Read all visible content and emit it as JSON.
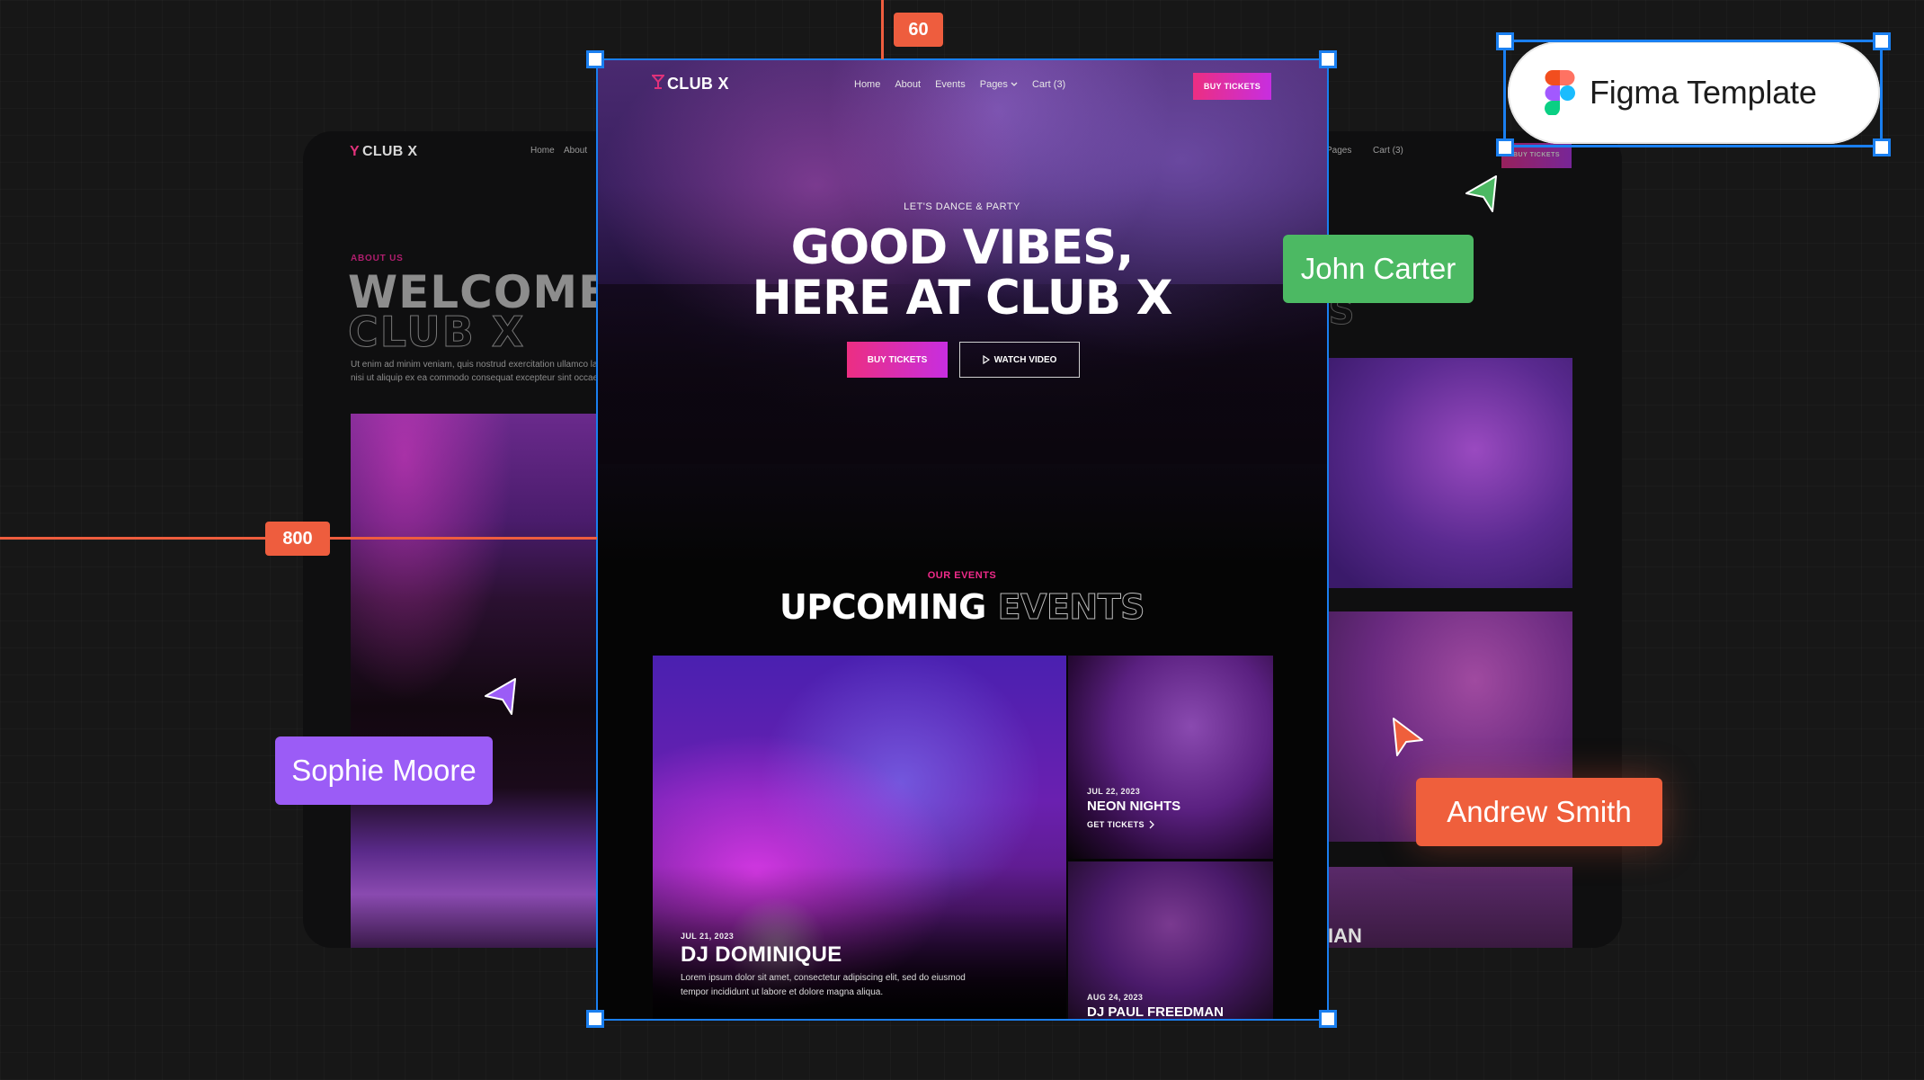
{
  "background_page": {
    "logo": "CLUB X",
    "nav": [
      "Home",
      "About",
      "Pages",
      "Cart (3)"
    ],
    "buy_label": "BUY TICKETS",
    "about_eyebrow": "ABOUT US",
    "welcome_line1": "WELCOME",
    "welcome_line2": "CLUB X",
    "body_line1": "Ut enim ad minim veniam, quis nostrud exercitation ullamco labo",
    "body_line2": "nisi ut aliquip ex ea commodo consequat excepteur sint occaecat",
    "events_ghost": "NTS",
    "partial_title": "IAN"
  },
  "frame": {
    "nav": {
      "logo": "CLUB X",
      "links": [
        "Home",
        "About",
        "Events",
        "Pages",
        "Cart (3)"
      ],
      "buy_label": "BUY TICKETS"
    },
    "hero": {
      "eyebrow": "LET'S DANCE & PARTY",
      "title_line1": "GOOD VIBES,",
      "title_line2": "HERE AT CLUB X",
      "primary_cta": "BUY TICKETS",
      "secondary_cta": "WATCH VIDEO"
    },
    "events": {
      "eyebrow": "OUR EVENTS",
      "title_solid": "UPCOMING",
      "title_outline": "EVENTS",
      "cards": [
        {
          "date": "JUL 21, 2023",
          "name": "DJ DOMINIQUE",
          "desc_line1": "Lorem ipsum dolor sit amet, consectetur adipiscing elit, sed do eiusmod",
          "desc_line2": "tempor incididunt ut labore et dolore magna aliqua."
        },
        {
          "date": "JUL 22, 2023",
          "name": "NEON NIGHTS",
          "link": "GET TICKETS"
        },
        {
          "date": "AUG 24, 2023",
          "name": "DJ PAUL FREEDMAN"
        }
      ]
    }
  },
  "measurements": {
    "top_spacing": "60",
    "left_spacing": "800"
  },
  "badge": {
    "label": "Figma Template"
  },
  "collaborators": [
    {
      "name": "John Carter",
      "color": "#4cb963"
    },
    {
      "name": "Sophie Moore",
      "color": "#9b5cf6"
    },
    {
      "name": "Andrew Smith",
      "color": "#ef5f3c"
    }
  ],
  "colors": {
    "accent_pink": "#ec2e82",
    "accent_purple": "#c72ee0",
    "selection_blue": "#1a7ff0",
    "measure_red": "#ee5d3e"
  }
}
